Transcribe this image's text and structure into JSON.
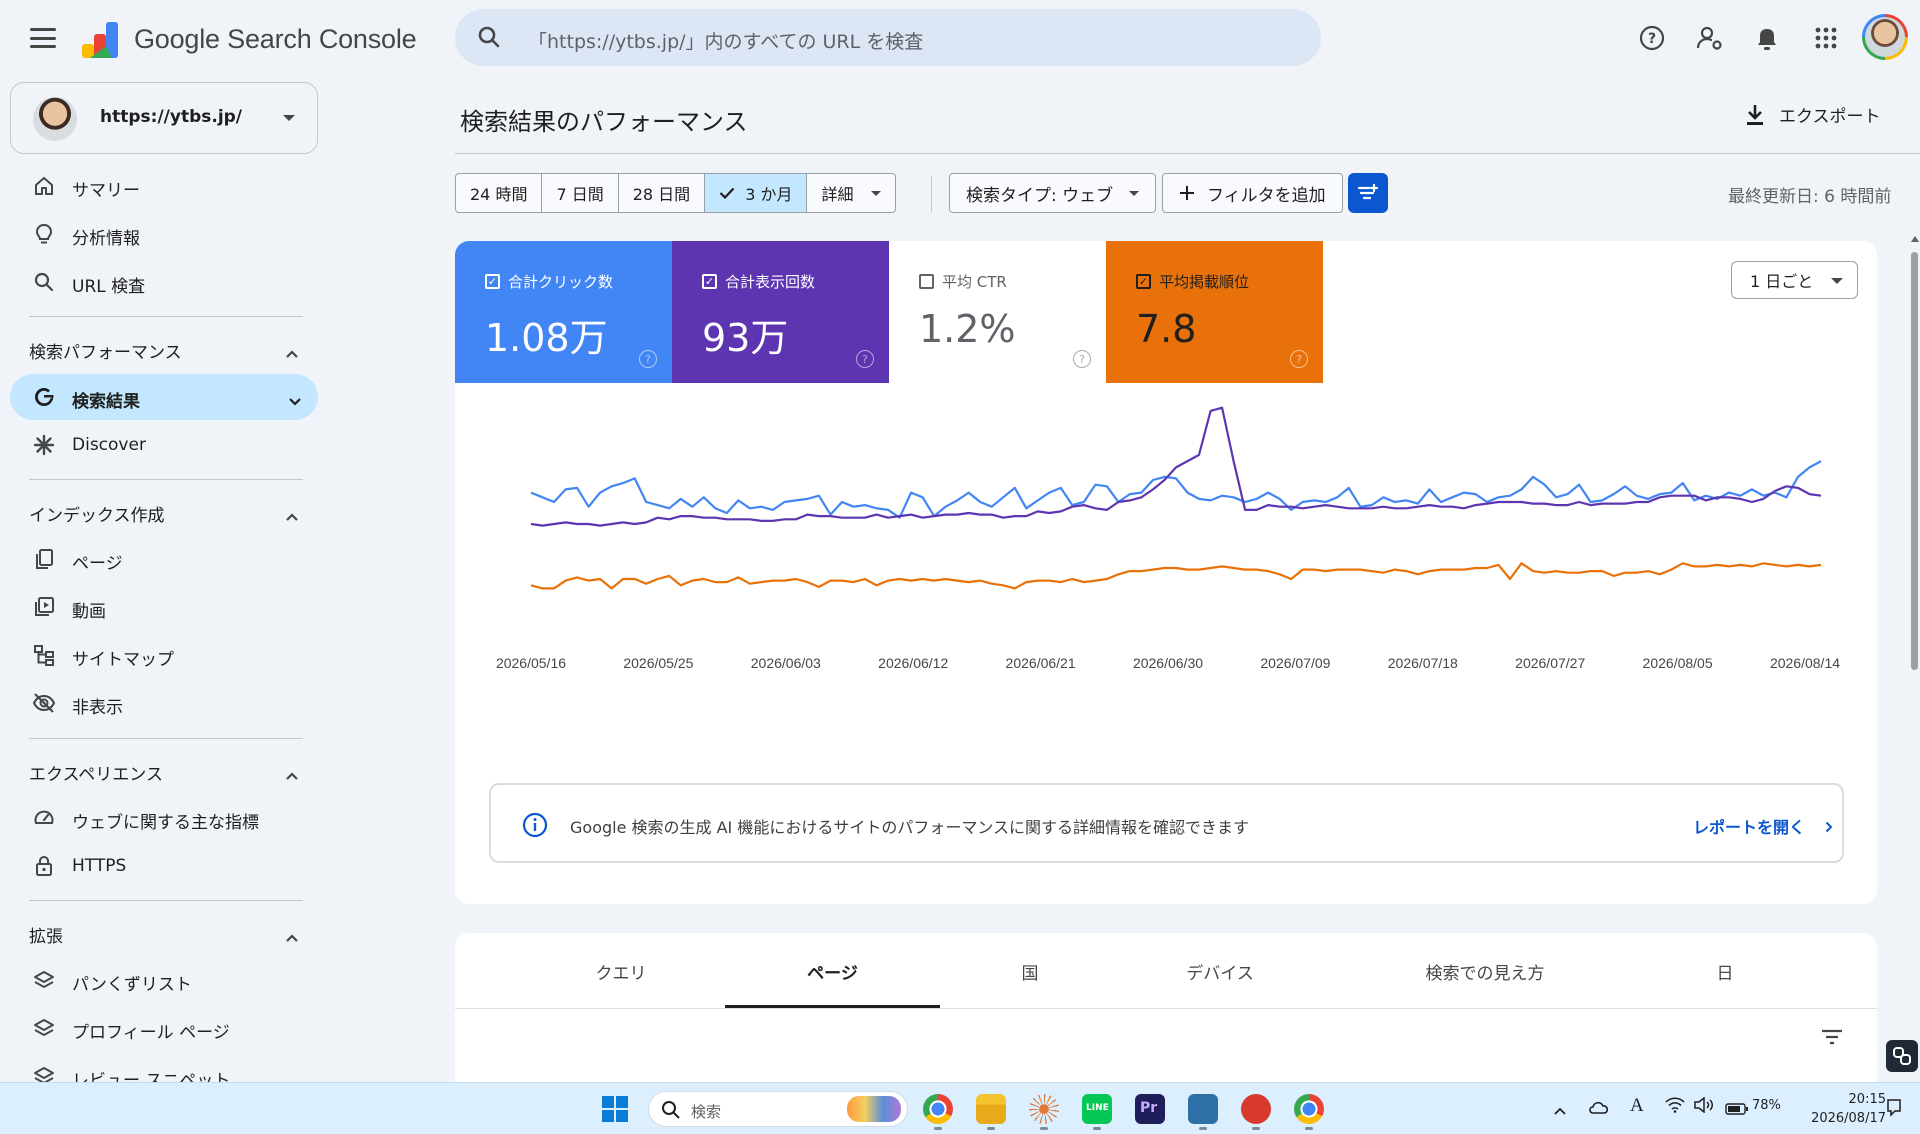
{
  "app": {
    "brand": "Google Search Console",
    "search_placeholder": "「https://ytbs.jp/」内のすべての URL を検査"
  },
  "property": {
    "url": "https://ytbs.jp/"
  },
  "sidebar": {
    "top_items": [
      {
        "label": "サマリー",
        "icon": "home-icon"
      },
      {
        "label": "分析情報",
        "icon": "lightbulb-icon"
      },
      {
        "label": "URL 検査",
        "icon": "search-icon"
      }
    ],
    "sections": [
      {
        "title": "検索パフォーマンス",
        "items": [
          {
            "label": "検索結果",
            "icon": "google-g-icon",
            "active": true
          },
          {
            "label": "Discover",
            "icon": "asterisk-icon"
          }
        ]
      },
      {
        "title": "インデックス作成",
        "items": [
          {
            "label": "ページ",
            "icon": "pages-icon"
          },
          {
            "label": "動画",
            "icon": "video-icon"
          },
          {
            "label": "サイトマップ",
            "icon": "sitemap-icon"
          },
          {
            "label": "非表示",
            "icon": "eye-off-icon"
          }
        ]
      },
      {
        "title": "エクスペリエンス",
        "items": [
          {
            "label": "ウェブに関する主な指標",
            "icon": "gauge-icon"
          },
          {
            "label": "HTTPS",
            "icon": "lock-icon"
          }
        ]
      },
      {
        "title": "拡張",
        "items": [
          {
            "label": "パンくずリスト",
            "icon": "layers-icon"
          },
          {
            "label": "プロフィール ページ",
            "icon": "layers-icon"
          },
          {
            "label": "レビュー スニペット",
            "icon": "layers-icon"
          }
        ]
      }
    ]
  },
  "main": {
    "title": "検索結果のパフォーマンス",
    "export_label": "エクスポート",
    "ranges": [
      "24 時間",
      "7 日間",
      "28 日間",
      "3 か月",
      "詳細"
    ],
    "selected_range": "3 か月",
    "search_type": "検索タイプ: ウェブ",
    "add_filter": "フィルタを追加",
    "last_updated": "最終更新日: 6 時間前",
    "granularity": "1 日ごと",
    "metrics": [
      {
        "label": "合計クリック数",
        "value": "1.08万",
        "checked": true,
        "color": "#4285f4"
      },
      {
        "label": "合計表示回数",
        "value": "93万",
        "checked": true,
        "color": "#5e35b1"
      },
      {
        "label": "平均 CTR",
        "value": "1.2%",
        "checked": false,
        "color": "#ffffff"
      },
      {
        "label": "平均掲載順位",
        "value": "7.8",
        "checked": true,
        "color": "#e8710a"
      }
    ],
    "info_text": "Google 検索の生成 AI 機能におけるサイトのパフォーマンスに関する詳細情報を確認できます",
    "info_link": "レポートを開く",
    "tabs": [
      "クエリ",
      "ページ",
      "国",
      "デバイス",
      "検索での見え方",
      "日"
    ],
    "selected_tab": "ページ"
  },
  "chart_data": {
    "type": "line",
    "x_ticks": [
      "2026/05/16",
      "2026/05/25",
      "2026/06/03",
      "2026/06/12",
      "2026/06/21",
      "2026/06/30",
      "2026/07/09",
      "2026/07/18",
      "2026/07/27",
      "2026/08/05",
      "2026/08/14"
    ],
    "series": [
      {
        "name": "合計クリック数",
        "color": "#4285f4",
        "values": [
          58,
          55,
          52,
          60,
          61,
          49,
          58,
          62,
          64,
          67,
          52,
          50,
          48,
          54,
          49,
          55,
          48,
          45,
          53,
          48,
          49,
          47,
          52,
          53,
          54,
          56,
          44,
          52,
          49,
          50,
          48,
          47,
          42,
          58,
          55,
          43,
          49,
          53,
          58,
          52,
          49,
          55,
          61,
          48,
          53,
          58,
          61,
          50,
          52,
          63,
          62,
          52,
          57,
          58,
          66,
          68,
          67,
          58,
          54,
          53,
          56,
          55,
          52,
          54,
          58,
          54,
          47,
          52,
          53,
          52,
          55,
          61,
          49,
          50,
          55,
          52,
          53,
          51,
          60,
          52,
          55,
          58,
          57,
          52,
          55,
          56,
          60,
          68,
          63,
          55,
          57,
          63,
          52,
          53,
          57,
          62,
          56,
          54,
          57,
          58,
          64,
          53,
          56,
          54,
          58,
          56,
          60,
          56,
          58,
          55,
          68,
          74,
          78
        ]
      },
      {
        "name": "合計表示回数",
        "color": "#5e35b1",
        "values": [
          38,
          37,
          38,
          39,
          38,
          38,
          37,
          38,
          39,
          38,
          39,
          42,
          41,
          43,
          43,
          42,
          42,
          41,
          41,
          41,
          40,
          40,
          41,
          41,
          44,
          43,
          43,
          42,
          42,
          42,
          44,
          42,
          43,
          44,
          42,
          43,
          44,
          44,
          45,
          44,
          44,
          42,
          43,
          43,
          46,
          45,
          46,
          49,
          50,
          48,
          47,
          52,
          53,
          55,
          60,
          66,
          74,
          78,
          82,
          110,
          112,
          78,
          47,
          47,
          50,
          49,
          49,
          48,
          49,
          50,
          49,
          48,
          48,
          48,
          49,
          48,
          48,
          49,
          50,
          49,
          49,
          48,
          50,
          51,
          52,
          52,
          52,
          51,
          51,
          50,
          50,
          52,
          50,
          51,
          51,
          51,
          52,
          52,
          55,
          56,
          56,
          56,
          53,
          55,
          55,
          54,
          52,
          54,
          59,
          62,
          61,
          57,
          56
        ]
      },
      {
        "name": "平均掲載順位",
        "color": "#e8710a",
        "values": [
          -1,
          -3,
          -3,
          2,
          4,
          2,
          3,
          -3,
          3,
          3,
          0,
          3,
          5,
          -1,
          2,
          3,
          1,
          1,
          4,
          0,
          1,
          2,
          2,
          3,
          1,
          -2,
          2,
          2,
          1,
          3,
          -1,
          2,
          3,
          2,
          3,
          2,
          3,
          2,
          1,
          2,
          0,
          -1,
          -3,
          1,
          2,
          2,
          1,
          3,
          1,
          2,
          3,
          6,
          8,
          8,
          9,
          10,
          10,
          9,
          9,
          10,
          11,
          10,
          9,
          9,
          8,
          6,
          3,
          9,
          9,
          8,
          9,
          9,
          9,
          8,
          7,
          9,
          8,
          6,
          8,
          9,
          9,
          9,
          10,
          10,
          12,
          3,
          13,
          8,
          7,
          8,
          7,
          7,
          8,
          8,
          5,
          7,
          7,
          8,
          6,
          9,
          13,
          11,
          11,
          12,
          11,
          12,
          11,
          13,
          12,
          11,
          12,
          11,
          12
        ]
      }
    ],
    "grid": false,
    "legend": "metric cards at top"
  },
  "taskbar": {
    "search_placeholder": "検索",
    "battery": "78%",
    "time": "20:15",
    "date": "2026/08/17"
  }
}
